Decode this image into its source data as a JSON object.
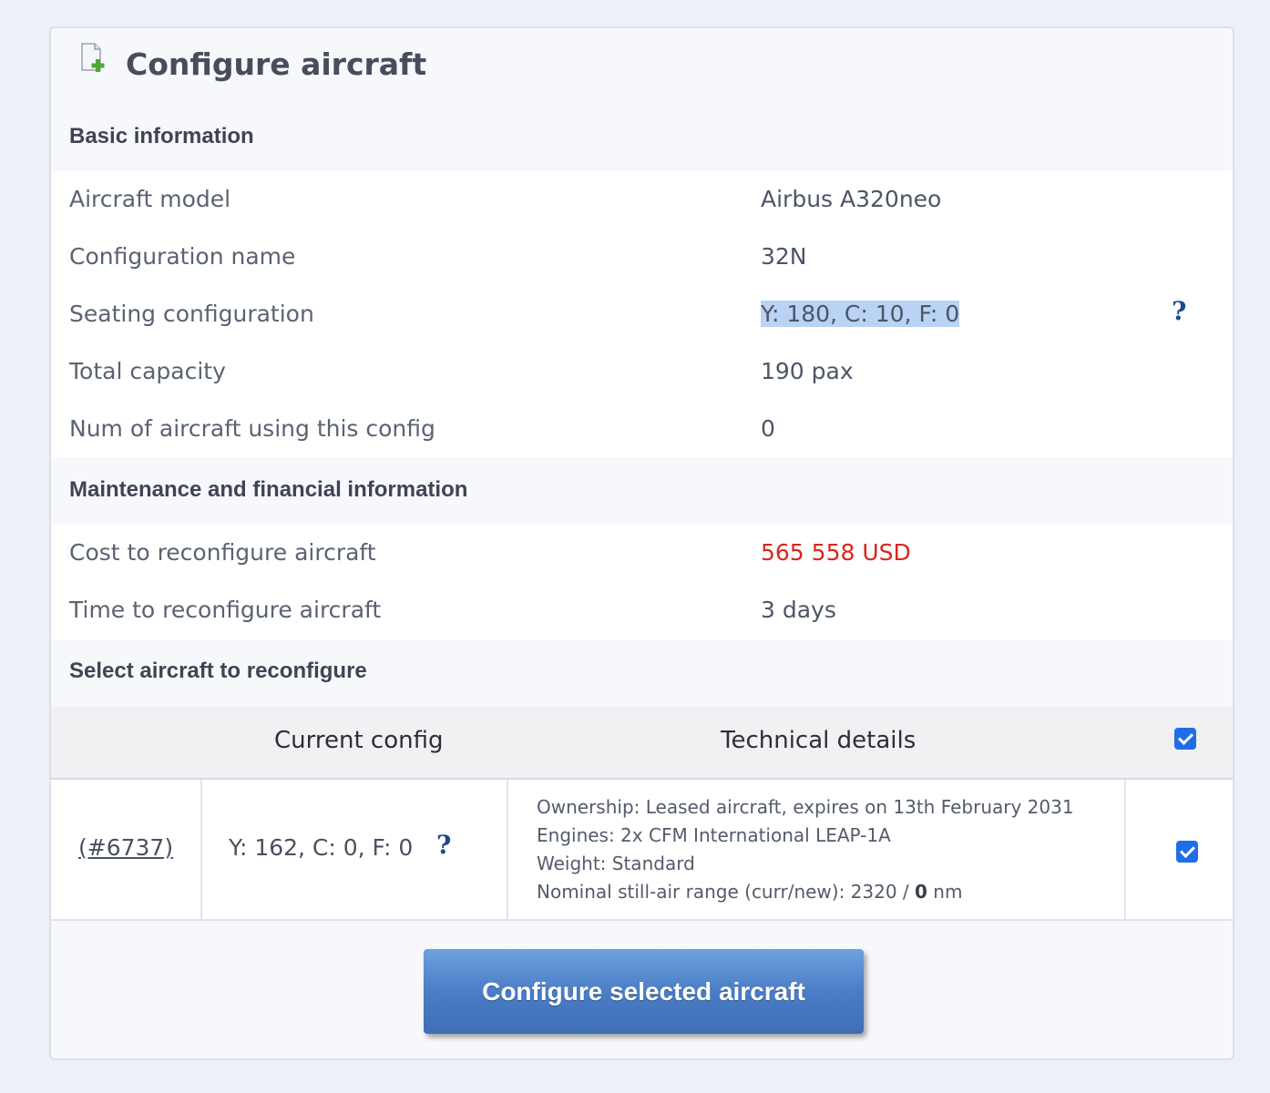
{
  "title": "Configure aircraft",
  "sections": {
    "basic": "Basic information",
    "maintenance": "Maintenance and financial information",
    "select": "Select aircraft to reconfigure"
  },
  "basic_info": [
    {
      "label": "Aircraft model",
      "value": "Airbus A320neo"
    },
    {
      "label": "Configuration name",
      "value": "32N"
    },
    {
      "label": "Seating configuration",
      "value": "Y: 180, C: 10, F: 0"
    },
    {
      "label": "Total capacity",
      "value": "190 pax"
    },
    {
      "label": "Num of aircraft using this config",
      "value": "0"
    }
  ],
  "maintenance_info": [
    {
      "label": "Cost to reconfigure aircraft",
      "value": "565 558 USD"
    },
    {
      "label": "Time to reconfigure aircraft",
      "value": "3 days"
    }
  ],
  "help_glyph": "?",
  "table": {
    "headers": {
      "current_config": "Current config",
      "technical_details": "Technical details"
    },
    "select_all_checked": true,
    "rows": [
      {
        "id": "(#6737)",
        "current_config": "Y: 162, C: 0, F: 0",
        "ownership": "Ownership: Leased aircraft, expires on 13th February 2031",
        "engines": "Engines: 2x CFM International LEAP-1A",
        "weight": "Weight: Standard",
        "range_prefix": "Nominal still-air range (curr/new): 2320 / ",
        "range_new": "0",
        "range_unit": " nm",
        "checked": true
      }
    ]
  },
  "button": {
    "label": "Configure selected aircraft"
  },
  "colors": {
    "accent_blue": "#1f6ee8",
    "cost_red": "#d9261c",
    "button_blue": "#4a7dc6",
    "help_blue": "#1e4a8c",
    "selection": "#b8d3f3"
  }
}
